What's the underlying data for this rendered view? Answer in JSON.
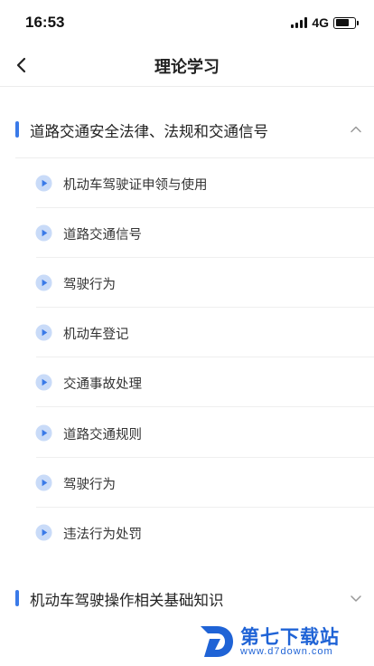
{
  "status": {
    "time": "16:53",
    "network": "4G",
    "battery_level": 0.72
  },
  "nav": {
    "title": "理论学习"
  },
  "sections": [
    {
      "title": "道路交通安全法律、法规和交通信号",
      "expanded": true,
      "items": [
        {
          "label": "机动车驾驶证申领与使用"
        },
        {
          "label": "道路交通信号"
        },
        {
          "label": "驾驶行为"
        },
        {
          "label": "机动车登记"
        },
        {
          "label": "交通事故处理"
        },
        {
          "label": "道路交通规则"
        },
        {
          "label": "驾驶行为"
        },
        {
          "label": "违法行为处罚"
        }
      ]
    },
    {
      "title": "机动车驾驶操作相关基础知识",
      "expanded": false,
      "items": []
    }
  ],
  "watermark": {
    "title": "第七下载站",
    "url": "www.d7down.com"
  },
  "colors": {
    "accent": "#3a7ae8",
    "play_icon_bg": "#c9dbf8",
    "watermark": "#1f63d6"
  }
}
